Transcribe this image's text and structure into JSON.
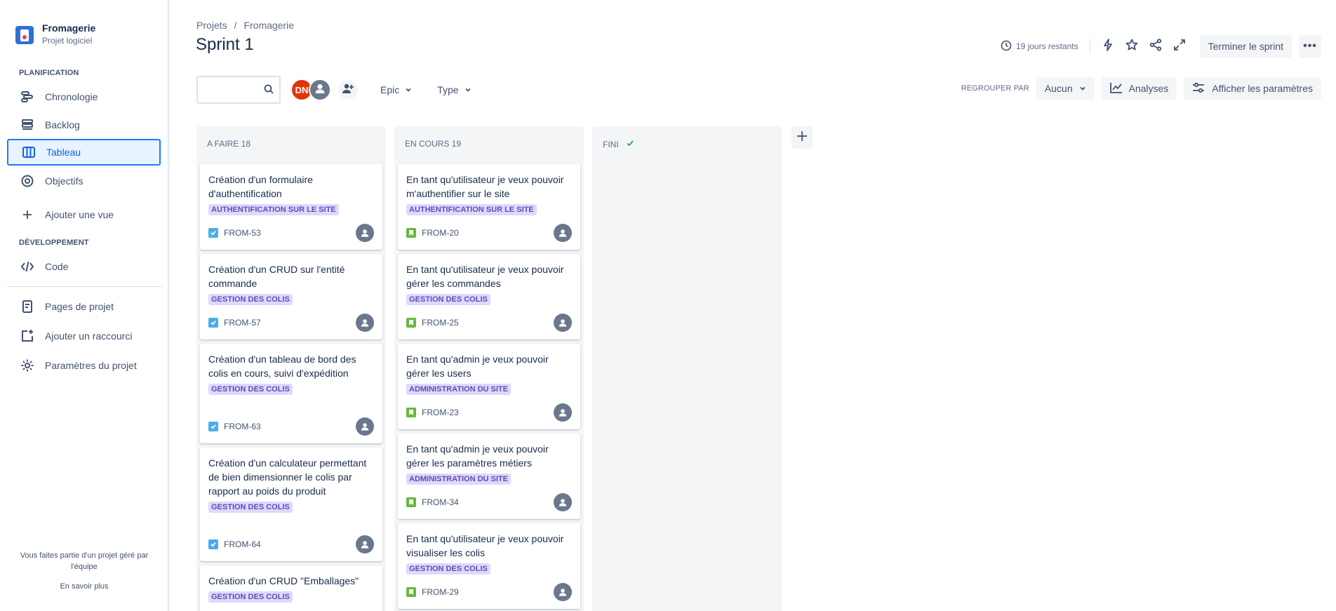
{
  "project": {
    "name": "Fromagerie",
    "type": "Projet logiciel"
  },
  "sidebar": {
    "planning_title": "PLANIFICATION",
    "planning_items": [
      {
        "label": "Chronologie",
        "icon": "timeline-icon"
      },
      {
        "label": "Backlog",
        "icon": "backlog-icon"
      },
      {
        "label": "Tableau",
        "icon": "board-icon",
        "active": true
      },
      {
        "label": "Objectifs",
        "icon": "goals-icon"
      },
      {
        "label": "Ajouter une vue",
        "icon": "plus-icon"
      }
    ],
    "dev_title": "DÉVELOPPEMENT",
    "dev_items": [
      {
        "label": "Code",
        "icon": "code-icon"
      }
    ],
    "bottom_items": [
      {
        "label": "Pages de projet",
        "icon": "page-icon"
      },
      {
        "label": "Ajouter un raccourci",
        "icon": "add-shortcut-icon"
      },
      {
        "label": "Paramètres du projet",
        "icon": "gear-icon"
      }
    ],
    "footer_text": "Vous faites partie d'un projet géré par l'équipe",
    "footer_link": "En savoir plus"
  },
  "breadcrumbs": [
    "Projets",
    "Fromagerie"
  ],
  "page_title": "Sprint 1",
  "top_actions": {
    "days_remaining": "19 jours restants",
    "complete_sprint": "Terminer le sprint"
  },
  "toolbar": {
    "search_placeholder": "",
    "avatar_initials": "DN",
    "filter_epic": "Epic",
    "filter_type": "Type",
    "group_by_label": "REGROUPER PAR",
    "group_by_value": "Aucun",
    "analyses": "Analyses",
    "settings": "Afficher les paramètres"
  },
  "colors": {
    "accent": "#0c66e4",
    "lozenge_bg": "#dfd8fd",
    "lozenge_text": "#5e4db2",
    "task": "#4bade8",
    "story": "#63ba3c",
    "avatar_dn": "#de350b"
  },
  "columns": [
    {
      "title": "A FAIRE 18",
      "cards": [
        {
          "title": "Création d'un formulaire d'authentification",
          "epic": "AUTHENTIFICATION SUR LE SITE",
          "key": "FROM-53",
          "kind": "task"
        },
        {
          "title": "Création d'un CRUD sur l'entité commande",
          "epic": "GESTION DES COLIS",
          "key": "FROM-57",
          "kind": "task"
        },
        {
          "title": "Création d'un tableau de bord des colis en cours, suivi d'expédition",
          "epic": "GESTION DES COLIS",
          "key": "FROM-63",
          "kind": "task"
        },
        {
          "title": "Création d'un calculateur permettant de bien dimensionner le colis par rapport au poids du produit",
          "epic": "GESTION DES COLIS",
          "key": "FROM-64",
          "kind": "task"
        },
        {
          "title": "Création d'un CRUD \"Emballages\"",
          "epic": "GESTION DES COLIS",
          "key": "",
          "kind": "task"
        }
      ]
    },
    {
      "title": "EN COURS 19",
      "cards": [
        {
          "title": "En tant qu'utilisateur je veux pouvoir m'authentifier sur le site",
          "epic": "AUTHENTIFICATION SUR LE SITE",
          "key": "FROM-20",
          "kind": "story"
        },
        {
          "title": "En tant qu'utilisateur je veux pouvoir gérer les commandes",
          "epic": "GESTION DES COLIS",
          "key": "FROM-25",
          "kind": "story"
        },
        {
          "title": "En tant qu'admin je veux pouvoir gérer les users",
          "epic": "ADMINISTRATION DU SITE",
          "key": "FROM-23",
          "kind": "story"
        },
        {
          "title": "En tant qu'admin je veux pouvoir gérer les paramètres métiers",
          "epic": "ADMINISTRATION DU SITE",
          "key": "FROM-34",
          "kind": "story"
        },
        {
          "title": "En tant qu'utilisateur je veux pouvoir visualiser les colis",
          "epic": "GESTION DES COLIS",
          "key": "FROM-29",
          "kind": "story"
        }
      ]
    },
    {
      "title": "FINI",
      "cards": []
    }
  ]
}
